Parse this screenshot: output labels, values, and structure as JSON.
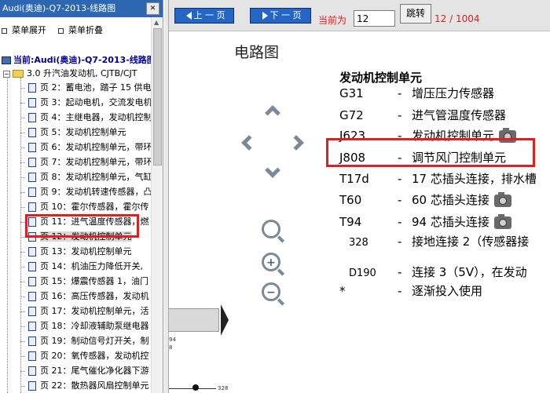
{
  "left_panel": {
    "title": "Audi(奥迪)-Q7-2013-线路图",
    "close_label": "✕",
    "actions": {
      "expand_label": "菜单展开",
      "collapse_label": "菜单折叠"
    },
    "tree": {
      "root_label": "当前:Audi(奥迪)-Q7-2013-线路图",
      "folder_label": "3.0 升汽油发动机, CJTB/CJT",
      "items": [
        "页 2：蓄电池，踏子 15 供电",
        "页 3：起动电机，交流发电机",
        "页 4：主继电器，发动机控制",
        "页 5：发动机控制单元",
        "页 6：发动机控制单元，带环",
        "页 7：发动机控制单元，带环",
        "页 8：发动机控制单元，气缸",
        "页 9：发动机转速传感器，凸",
        "页 10：霍尔传感器，霍尔传",
        "页 11：进气温度传感器，燃",
        "页 12：发动机控制单元",
        "页 13：发动机控制单元",
        "页 14：机油压力降低开关,",
        "页 15：爆震传感器 1，油门",
        "页 16：高压传感器，发动机",
        "页 17：发动机控制单元，活",
        "页 18：冷却液辅助泵继电器",
        "页 19：制动信号灯开关，制",
        "页 20：氧传感器，发动机控",
        "页 21：尾气催化净化器下游",
        "页 22：散热器风扇控制单元",
        "页 23：预供给燃油泵，燃油"
      ],
      "selected_index": 10
    }
  },
  "toolbar": {
    "prev_label": "上 一 页",
    "next_label": "下 一 页",
    "current_label": "当前为",
    "page_value": "12",
    "goto_label": "跳转",
    "page_count": "12 / 1004"
  },
  "document": {
    "title": "电路图",
    "component_title": "发动机控制单元",
    "rows": [
      {
        "code": "G31",
        "desc": "增压压力传感器",
        "camera": false
      },
      {
        "code": "G72",
        "desc": "进气管温度传感器",
        "camera": false
      },
      {
        "code": "J623",
        "desc": "发动机控制单元",
        "camera": true
      },
      {
        "code": "J808",
        "desc": "调节风门控制单元",
        "camera": false
      },
      {
        "code": "T17d",
        "desc": "17 芯插头连接，排水槽",
        "camera": false
      },
      {
        "code": "T60",
        "desc": "60 芯插头连接",
        "camera": true
      },
      {
        "code": "T94",
        "desc": "94 芯插头连接",
        "camera": true
      },
      {
        "code": "328",
        "desc": "接地连接 2（传感器接",
        "camera": false
      },
      {
        "code": "D190",
        "desc": "连接 3（5V），在发动",
        "camera": false
      },
      {
        "code": "*",
        "desc": "逐渐投入使用",
        "camera": false
      }
    ],
    "dash": "-",
    "diagram_labels": {
      "label_a": "94",
      "label_b": "8",
      "label_c": "328"
    }
  },
  "colors": {
    "accent_blue": "#2566c5",
    "highlight_red": "#e0201e",
    "title_bar": "#2e67b1"
  }
}
